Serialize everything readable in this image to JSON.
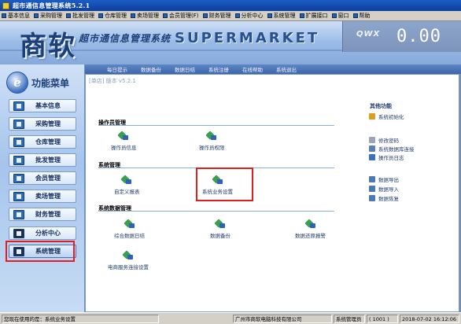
{
  "window": {
    "title": "超市通信息管理系统5.2.1"
  },
  "menu": [
    {
      "label": "基本信息",
      "icon": "basic-info-icon"
    },
    {
      "label": "采购管理",
      "icon": "purchase-icon"
    },
    {
      "label": "批发管理",
      "icon": "wholesale-icon"
    },
    {
      "label": "仓库管理",
      "icon": "warehouse-icon"
    },
    {
      "label": "卖场管理",
      "icon": "store-icon"
    },
    {
      "label": "会员管理(F)",
      "icon": "member-icon"
    },
    {
      "label": "财务管理",
      "icon": "finance-icon"
    },
    {
      "label": "分析中心",
      "icon": "analysis-icon"
    },
    {
      "label": "系统管理",
      "icon": "system-icon"
    },
    {
      "label": "扩展接口",
      "icon": "extension-icon"
    },
    {
      "label": "窗口",
      "icon": "window-icon"
    },
    {
      "label": "帮助",
      "icon": "help-icon"
    }
  ],
  "banner": {
    "brand": "商软",
    "subtitle": "超市通信息管理系统",
    "english": "SUPERMARKET",
    "logo_text": "QWX",
    "amount": "0.00"
  },
  "nav_links": [
    "每日提示",
    "数据备份",
    "数据日结",
    "系统注册",
    "在线帮助",
    "系统退出"
  ],
  "sidebar": {
    "title": "功能菜单",
    "logo_letter": "e",
    "items": [
      {
        "label": "基本信息",
        "icon": "basic-info-icon"
      },
      {
        "label": "采购管理",
        "icon": "purchase-icon"
      },
      {
        "label": "仓库管理",
        "icon": "warehouse-icon"
      },
      {
        "label": "批发管理",
        "icon": "wholesale-icon"
      },
      {
        "label": "会员管理",
        "icon": "member-icon"
      },
      {
        "label": "卖场管理",
        "icon": "store-icon"
      },
      {
        "label": "财务管理",
        "icon": "finance-icon"
      },
      {
        "label": "分析中心",
        "icon": "analysis-icon"
      },
      {
        "label": "系统管理",
        "icon": "system-icon"
      }
    ]
  },
  "content": {
    "version": "[单店] 版本 v5.2.1",
    "sections": [
      {
        "title": "操作员管理",
        "items": [
          "操作员信息",
          "操作员权限"
        ]
      },
      {
        "title": "系统管理",
        "items": [
          "自定义报表",
          "系统业务设置"
        ]
      },
      {
        "title": "系统数据管理",
        "items": [
          "综合数据日结",
          "数据备份",
          "数据还原报警",
          "电商服务连接设置"
        ]
      }
    ],
    "right_panel": {
      "title": "其他功能",
      "items": [
        "系统初始化",
        "修改密码",
        "系统数据库连接",
        "操作员日志",
        "数据导出",
        "数据导入",
        "数据恢复"
      ]
    }
  },
  "status": {
    "module": "您现在使用的是：系统业务设置",
    "company": "广州市商软电脑科技有限公司",
    "user": "系统管理员",
    "user_id": "( 1001 )",
    "datetime": "2018-07-02 16:12:06"
  },
  "colors": {
    "highlight": "#e02020",
    "title_bar": "#1c5cc4"
  }
}
